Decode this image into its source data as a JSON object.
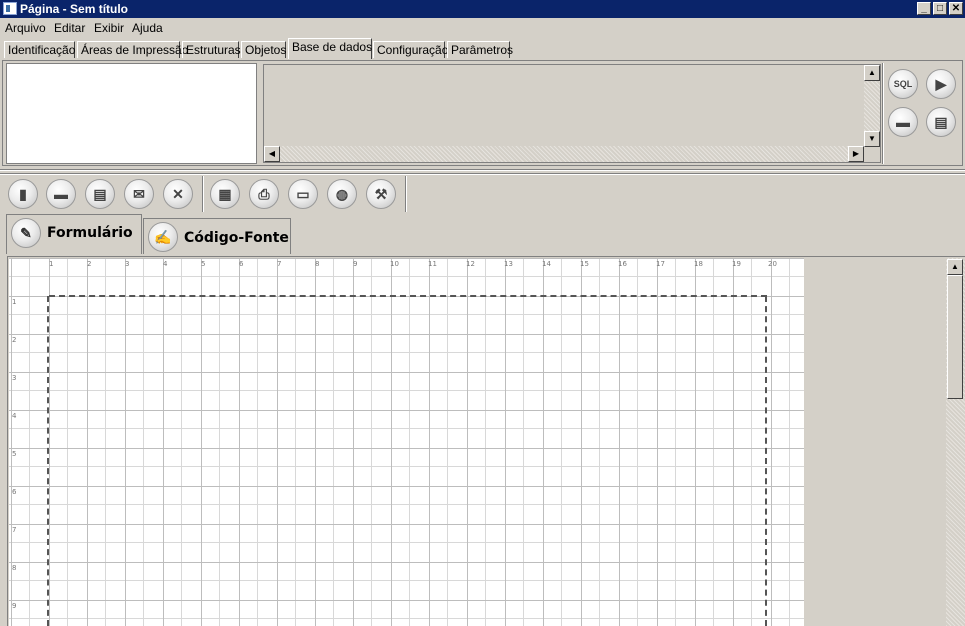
{
  "window": {
    "title": "Página - Sem título"
  },
  "menu": [
    "Arquivo",
    "Editar",
    "Exibir",
    "Ajuda"
  ],
  "tabs": [
    "Identificação",
    "Áreas de Impressão",
    "Estruturas",
    "Objetos",
    "Base de dados",
    "Configuração",
    "Parâmetros"
  ],
  "active_tab": "Base de dados",
  "sql_panel": {
    "sql_button": "SQL"
  },
  "editor_tabs": [
    "Formulário",
    "Código-Fonte"
  ],
  "ruler": {
    "top": [
      "1",
      "2",
      "3",
      "4",
      "5",
      "6",
      "7",
      "8",
      "9",
      "10",
      "11",
      "12",
      "13",
      "14",
      "15",
      "16",
      "17",
      "18",
      "19",
      "20"
    ],
    "left": [
      "1",
      "2",
      "3",
      "4",
      "5",
      "6",
      "7",
      "8",
      "9"
    ]
  },
  "colors": {
    "titlebar": "#0a246a",
    "chrome": "#d4d0c8"
  }
}
